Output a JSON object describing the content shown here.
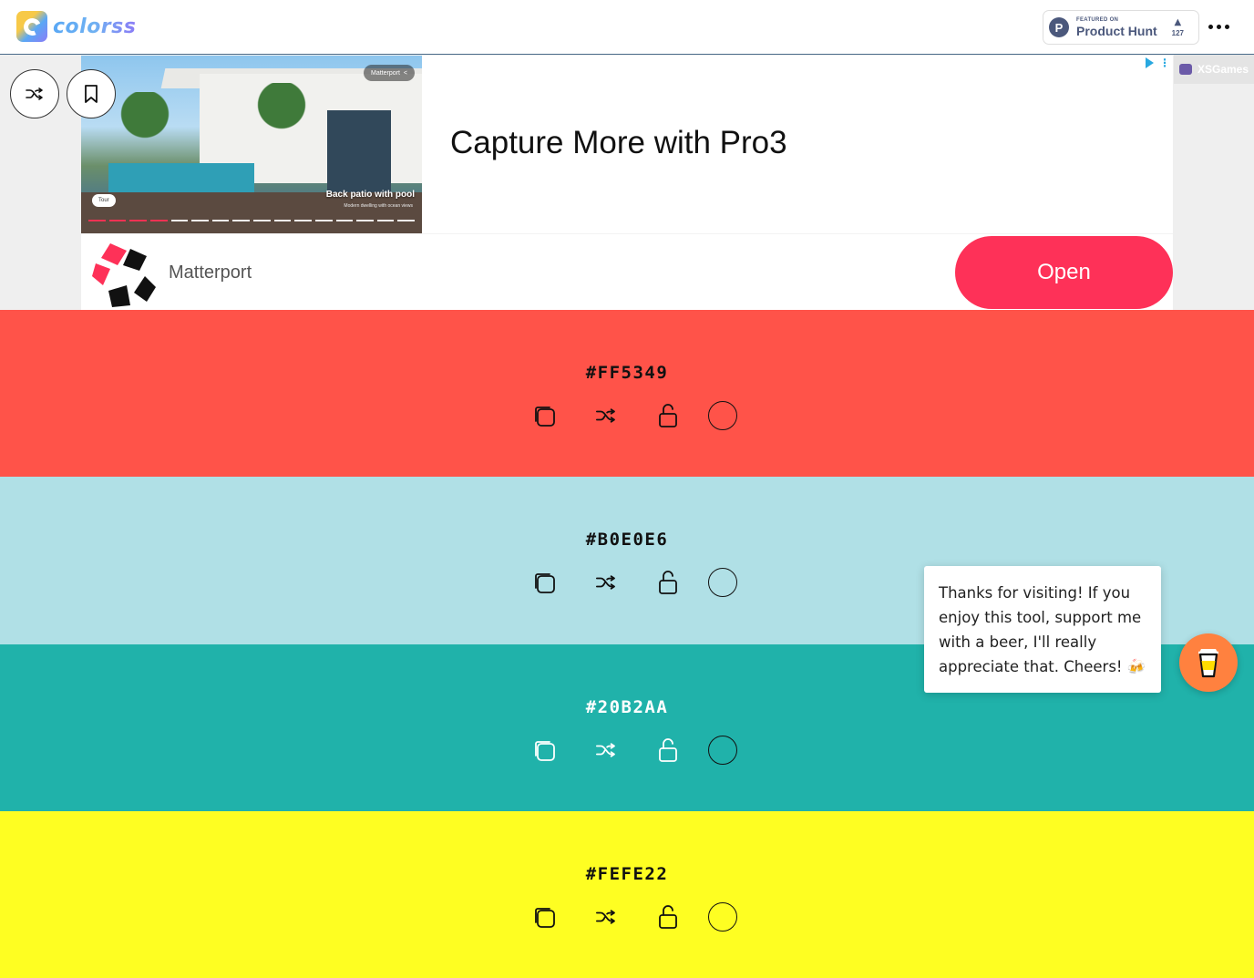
{
  "header": {
    "logo_text": "colorss",
    "product_hunt": {
      "featured_label": "FEATURED ON",
      "name": "Product Hunt",
      "votes": "127",
      "circle_letter": "P"
    }
  },
  "ad": {
    "image": {
      "brand_tag": "Matterport",
      "caption": "Back patio with pool",
      "caption_sub": "Modern dwelling with ocean views",
      "tour_label": "Tour"
    },
    "headline": "Capture More with Pro3",
    "advertiser": "Matterport",
    "cta": "Open",
    "side_label": "XSGames",
    "accent_color": "#fe3158"
  },
  "colors": [
    {
      "hex": "#FF5349",
      "bg": "#FF5349",
      "fg": "#111111"
    },
    {
      "hex": "#B0E0E6",
      "bg": "#B0E0E6",
      "fg": "#111111"
    },
    {
      "hex": "#20B2AA",
      "bg": "#20B2AA",
      "fg": "#FFFFFF"
    },
    {
      "hex": "#FEFE22",
      "bg": "#FEFE22",
      "fg": "#111111"
    }
  ],
  "tooltip": {
    "text": "Thanks for visiting! If you enjoy this tool, support me with a beer, I'll really appreciate that. Cheers! 🍻"
  },
  "icons": {
    "copy": "copy-icon",
    "shuffle": "shuffle-icon",
    "lock": "unlock-icon",
    "bookmark": "bookmark-icon",
    "beer": "beer-cup-icon"
  }
}
